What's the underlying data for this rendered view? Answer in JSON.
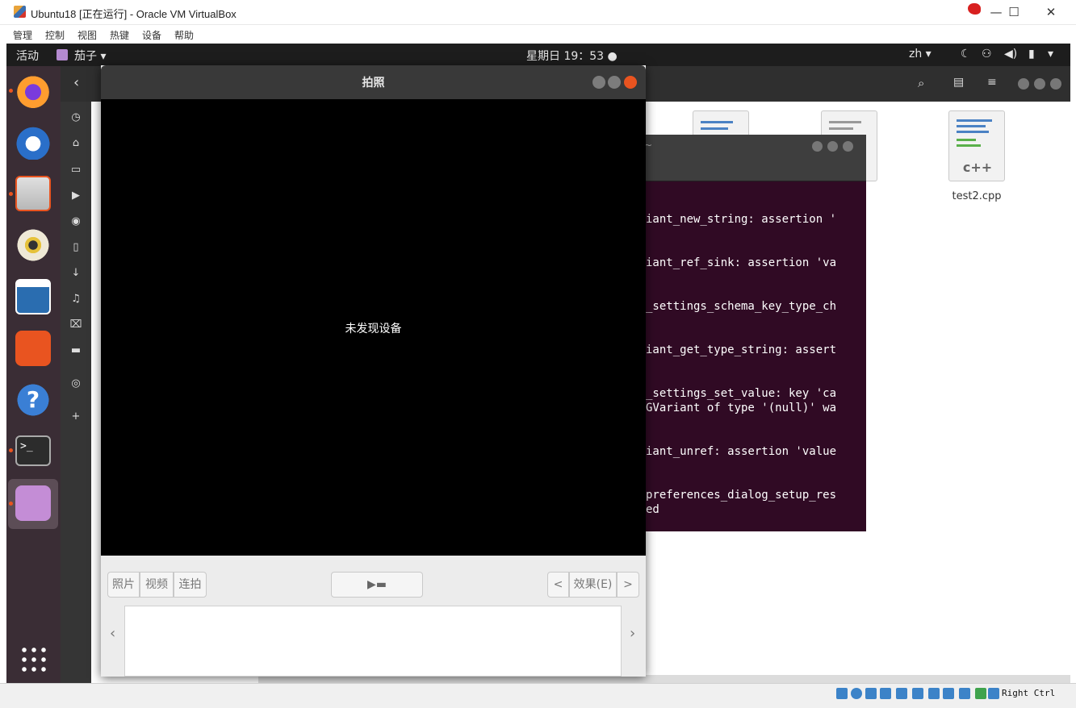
{
  "host_window": {
    "title": "Ubuntu18 [正在运行] - Oracle VM VirtualBox",
    "controls": {
      "minimize": "—",
      "maximize": "☐",
      "close": "✕"
    },
    "menu": [
      "管理",
      "控制",
      "视图",
      "热键",
      "设备",
      "帮助"
    ],
    "host_key": "Right Ctrl"
  },
  "topbar": {
    "activities": "活动",
    "app_menu": "茄子 ▾",
    "clock": "星期日 19：53 ●",
    "input_method": "zh ▾"
  },
  "dock": {
    "apps": [
      {
        "name": "firefox-icon",
        "color": "#ff7139"
      },
      {
        "name": "thunderbird-icon",
        "color": "#2a6fc9"
      },
      {
        "name": "files-icon",
        "color": "#d9d9d9"
      },
      {
        "name": "rhythmbox-icon",
        "color": "#e8e3d0"
      },
      {
        "name": "libreoffice-writer-icon",
        "color": "#2a6db0"
      },
      {
        "name": "software-center-icon",
        "color": "#e95420"
      },
      {
        "name": "help-icon",
        "color": "#3a7fd5"
      },
      {
        "name": "terminal-icon",
        "color": "#2c2c2c"
      },
      {
        "name": "cheese-icon",
        "color": "#c48dd6"
      }
    ]
  },
  "files": {
    "file_name": "test2.cpp",
    "file_badge": "c++"
  },
  "terminal": {
    "title": "~",
    "lines": [
      "iant_new_string: assertion '",
      "iant_ref_sink: assertion 'va",
      "_settings_schema_key_type_ch",
      "iant_get_type_string: assert",
      "_settings_set_value: key 'ca",
      "GVariant of type '(null)' wa",
      "iant_unref: assertion 'value",
      "preferences_dialog_setup_res",
      "ed"
    ]
  },
  "cheese": {
    "title": "拍照",
    "message": "未发现设备",
    "mode_buttons": [
      "照片",
      "视频",
      "连拍"
    ],
    "effects_label": "效果(E)",
    "prev_arrow": "<",
    "next_arrow": ">",
    "thumb_prev": "‹",
    "thumb_next": "›"
  }
}
